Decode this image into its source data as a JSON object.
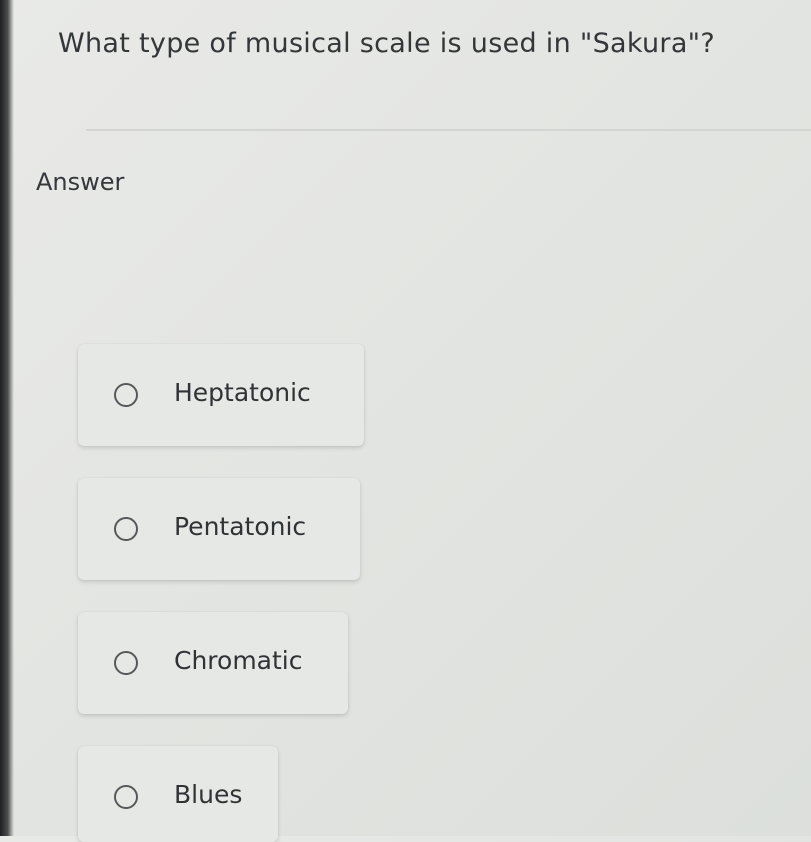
{
  "question": {
    "text": "What type of musical scale is used in \"Sakura\"?"
  },
  "answer_section": {
    "label": "Answer"
  },
  "options": [
    {
      "label": "Heptatonic",
      "selected": false
    },
    {
      "label": "Pentatonic",
      "selected": false
    },
    {
      "label": "Chromatic",
      "selected": false
    },
    {
      "label": "Blues",
      "selected": false
    }
  ]
}
